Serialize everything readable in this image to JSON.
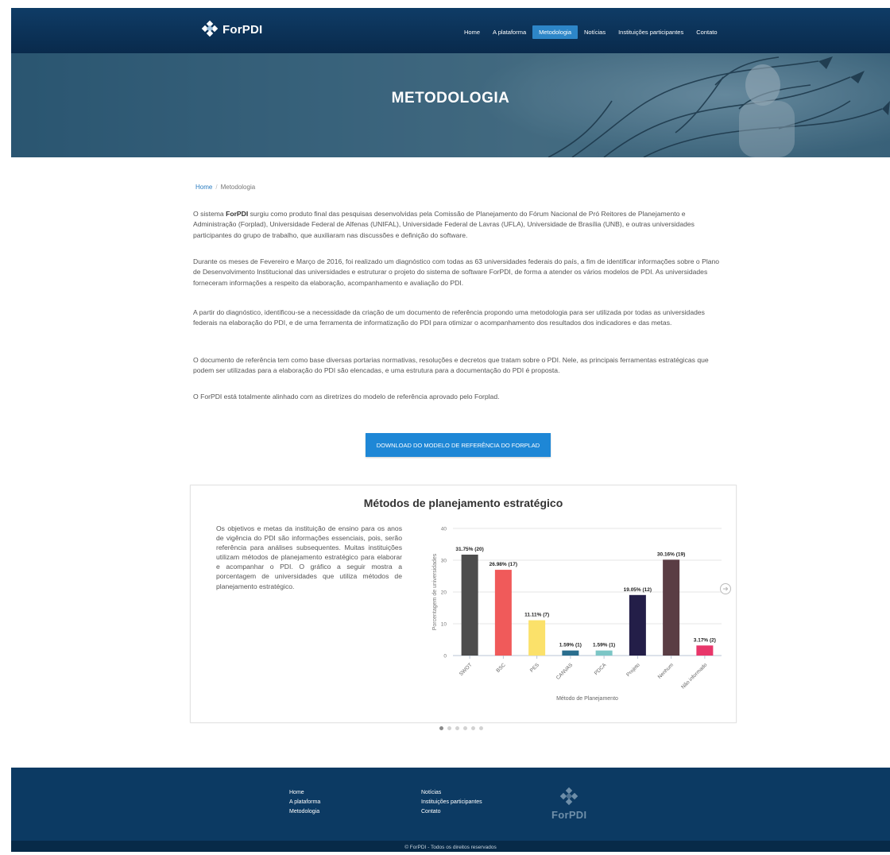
{
  "brand": {
    "name": "ForPDI"
  },
  "nav": {
    "items": [
      {
        "label": "Home",
        "active": false
      },
      {
        "label": "A plataforma",
        "active": false
      },
      {
        "label": "Metodologia",
        "active": true
      },
      {
        "label": "Notícias",
        "active": false
      },
      {
        "label": "Instituições participantes",
        "active": false
      },
      {
        "label": "Contato",
        "active": false
      }
    ]
  },
  "hero": {
    "title": "METODOLOGIA"
  },
  "breadcrumb": {
    "home": "Home",
    "separator": "/",
    "current": "Metodologia"
  },
  "content": {
    "p1_prefix": "O sistema ",
    "p1_bold": "ForPDI",
    "p1_rest": " surgiu como produto final das pesquisas desenvolvidas pela Comissão de Planejamento do Fórum Nacional de Pró Reitores de Planejamento e Administração (Forplad), Universidade Federal de Alfenas (UNIFAL), Universidade Federal de Lavras (UFLA), Universidade de Brasília (UNB), e outras universidades participantes do grupo de trabalho, que auxiliaram nas discussões e definição do software.",
    "p2": "Durante os meses de Fevereiro e Março de 2016, foi realizado um diagnóstico com todas as 63 universidades federais do país, a fim de identificar informações sobre o Plano de Desenvolvimento Institucional das universidades e estruturar o projeto do sistema de software ForPDI, de forma a atender os vários modelos de PDI. As universidades forneceram informações a respeito da elaboração, acompanhamento e avaliação do PDI.",
    "p3": "A partir do diagnóstico, identificou-se a necessidade da criação de um documento de referência propondo uma metodologia para ser utilizada por todas as universidades federais na elaboração do PDI, e de uma ferramenta de informatização do PDI para otimizar o acompanhamento dos resultados dos indicadores e das metas.",
    "p4": "O documento de referência tem como base diversas portarias normativas, resoluções e decretos que tratam sobre o PDI. Nele, as principais ferramentas estratégicas que podem ser utilizadas para a elaboração do PDI são elencadas, e uma estrutura para a documentação do PDI é proposta.",
    "p5": "O ForPDI está totalmente alinhado com as diretrizes do modelo de referência aprovado pelo Forplad.",
    "download_label": "DOWNLOAD DO MODELO DE REFERÊNCIA DO FORPLAD"
  },
  "carousel": {
    "title": "Métodos de planejamento estratégico",
    "text": "Os objetivos e metas da instituição de ensino para os anos de vigência do PDI são informações essenciais, pois, serão referência para análises subsequentes. Muitas instituições utilizam métodos de planejamento estratégico para elaborar e acompanhar o PDI. O gráfico a seguir mostra a porcentagem de universidades que utiliza métodos de planejamento estratégico.",
    "slides": 6,
    "active_slide": 0
  },
  "chart_data": {
    "type": "bar",
    "title": "",
    "xlabel": "Método de Planejamento",
    "ylabel": "Porcentagem de universidades",
    "ylim": [
      0,
      40
    ],
    "yticks": [
      0,
      10,
      20,
      30,
      40
    ],
    "grid": true,
    "categories": [
      "SWOT",
      "BSC",
      "PES",
      "CANVAS",
      "PDCA",
      "Projeto",
      "Nenhum",
      "Não informado"
    ],
    "values": [
      31.75,
      26.98,
      11.11,
      1.59,
      1.59,
      19.05,
      30.16,
      3.17
    ],
    "counts": [
      20,
      17,
      7,
      1,
      1,
      12,
      19,
      2
    ],
    "data_labels": [
      "31.75% (20)",
      "26.98% (17)",
      "11.11% (7)",
      "1.59% (1)",
      "1.59% (1)",
      "19.05% (12)",
      "30.16% (19)",
      "3.17% (2)"
    ],
    "colors": [
      "#4d4d4d",
      "#f05a5a",
      "#fbe16a",
      "#2a6e8e",
      "#7cc6c6",
      "#231e48",
      "#5a3d44",
      "#e8366a"
    ]
  },
  "footer": {
    "col1": [
      "Home",
      "A plataforma",
      "Metodologia"
    ],
    "col2": [
      "Notícias",
      "Instituições participantes",
      "Contato"
    ],
    "logo_text": "ForPDI",
    "copyright": "© ForPDI - Todos os direitos reservados"
  }
}
